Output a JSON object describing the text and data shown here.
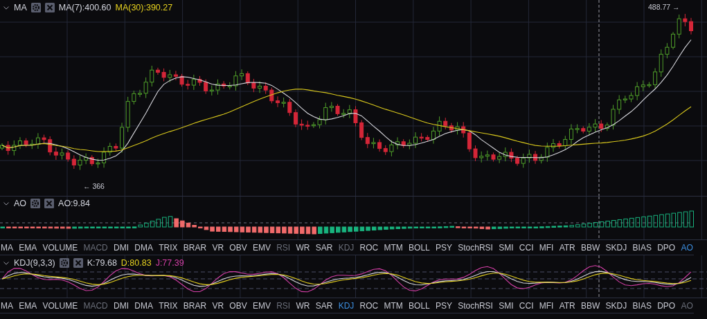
{
  "main": {
    "name": "MA",
    "params": [
      {
        "text": "MA(7):400.60",
        "color": "#d3d5de"
      },
      {
        "text": "MA(30):390.27",
        "color": "#e6d11f"
      }
    ],
    "low_label": "← 366",
    "high_label": "488.77 →"
  },
  "ao": {
    "name": "AO",
    "params": [
      {
        "text": "AO:9.84",
        "color": "#d3d5de"
      }
    ]
  },
  "tabs_1": [
    {
      "label": "MA",
      "selected": false,
      "disabled": false
    },
    {
      "label": "EMA",
      "selected": false,
      "disabled": false
    },
    {
      "label": "VOLUME",
      "selected": false,
      "disabled": false
    },
    {
      "label": "MACD",
      "selected": false,
      "disabled": true
    },
    {
      "label": "DMI",
      "selected": false,
      "disabled": false
    },
    {
      "label": "DMA",
      "selected": false,
      "disabled": false
    },
    {
      "label": "TRIX",
      "selected": false,
      "disabled": false
    },
    {
      "label": "BRAR",
      "selected": false,
      "disabled": false
    },
    {
      "label": "VR",
      "selected": false,
      "disabled": false
    },
    {
      "label": "OBV",
      "selected": false,
      "disabled": false
    },
    {
      "label": "EMV",
      "selected": false,
      "disabled": false
    },
    {
      "label": "RSI",
      "selected": false,
      "disabled": true
    },
    {
      "label": "WR",
      "selected": false,
      "disabled": false
    },
    {
      "label": "SAR",
      "selected": false,
      "disabled": false
    },
    {
      "label": "KDJ",
      "selected": false,
      "disabled": true
    },
    {
      "label": "ROC",
      "selected": false,
      "disabled": false
    },
    {
      "label": "MTM",
      "selected": false,
      "disabled": false
    },
    {
      "label": "BOLL",
      "selected": false,
      "disabled": false
    },
    {
      "label": "PSY",
      "selected": false,
      "disabled": false
    },
    {
      "label": "StochRSI",
      "selected": false,
      "disabled": false
    },
    {
      "label": "SMI",
      "selected": false,
      "disabled": false
    },
    {
      "label": "CCI",
      "selected": false,
      "disabled": false
    },
    {
      "label": "MFI",
      "selected": false,
      "disabled": false
    },
    {
      "label": "ATR",
      "selected": false,
      "disabled": false
    },
    {
      "label": "BBW",
      "selected": false,
      "disabled": false
    },
    {
      "label": "SKDJ",
      "selected": false,
      "disabled": false
    },
    {
      "label": "BIAS",
      "selected": false,
      "disabled": false
    },
    {
      "label": "DPO",
      "selected": false,
      "disabled": false
    },
    {
      "label": "AO",
      "selected": true,
      "disabled": false
    }
  ],
  "kdj": {
    "name": "KDJ(9,3,3)",
    "params": [
      {
        "text": "K:79.68",
        "color": "#d3d5de"
      },
      {
        "text": "D:80.83",
        "color": "#e6d11f"
      },
      {
        "text": "J:77.39",
        "color": "#d63fa8"
      }
    ]
  },
  "tabs_2": [
    {
      "label": "MA",
      "selected": false,
      "disabled": false
    },
    {
      "label": "EMA",
      "selected": false,
      "disabled": false
    },
    {
      "label": "VOLUME",
      "selected": false,
      "disabled": false
    },
    {
      "label": "MACD",
      "selected": false,
      "disabled": true
    },
    {
      "label": "DMI",
      "selected": false,
      "disabled": false
    },
    {
      "label": "DMA",
      "selected": false,
      "disabled": false
    },
    {
      "label": "TRIX",
      "selected": false,
      "disabled": false
    },
    {
      "label": "BRAR",
      "selected": false,
      "disabled": false
    },
    {
      "label": "VR",
      "selected": false,
      "disabled": false
    },
    {
      "label": "OBV",
      "selected": false,
      "disabled": false
    },
    {
      "label": "EMV",
      "selected": false,
      "disabled": false
    },
    {
      "label": "RSI",
      "selected": false,
      "disabled": true
    },
    {
      "label": "WR",
      "selected": false,
      "disabled": false
    },
    {
      "label": "SAR",
      "selected": false,
      "disabled": false
    },
    {
      "label": "KDJ",
      "selected": true,
      "disabled": false
    },
    {
      "label": "ROC",
      "selected": false,
      "disabled": false
    },
    {
      "label": "MTM",
      "selected": false,
      "disabled": false
    },
    {
      "label": "BOLL",
      "selected": false,
      "disabled": false
    },
    {
      "label": "PSY",
      "selected": false,
      "disabled": false
    },
    {
      "label": "StochRSI",
      "selected": false,
      "disabled": false
    },
    {
      "label": "SMI",
      "selected": false,
      "disabled": false
    },
    {
      "label": "CCI",
      "selected": false,
      "disabled": false
    },
    {
      "label": "MFI",
      "selected": false,
      "disabled": false
    },
    {
      "label": "ATR",
      "selected": false,
      "disabled": false
    },
    {
      "label": "BBW",
      "selected": false,
      "disabled": false
    },
    {
      "label": "SKDJ",
      "selected": false,
      "disabled": false
    },
    {
      "label": "BIAS",
      "selected": false,
      "disabled": false
    },
    {
      "label": "DPO",
      "selected": false,
      "disabled": false
    },
    {
      "label": "AO",
      "selected": false,
      "disabled": true
    }
  ]
}
